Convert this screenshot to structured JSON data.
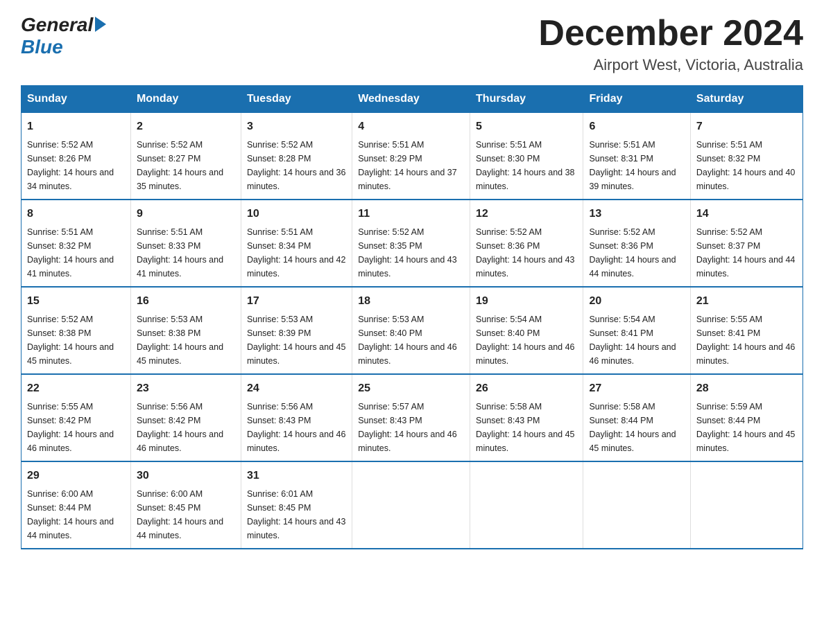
{
  "logo": {
    "text1": "General",
    "text2": "Blue"
  },
  "title": "December 2024",
  "location": "Airport West, Victoria, Australia",
  "days_of_week": [
    "Sunday",
    "Monday",
    "Tuesday",
    "Wednesday",
    "Thursday",
    "Friday",
    "Saturday"
  ],
  "weeks": [
    [
      {
        "day": "1",
        "sunrise": "5:52 AM",
        "sunset": "8:26 PM",
        "daylight": "14 hours and 34 minutes."
      },
      {
        "day": "2",
        "sunrise": "5:52 AM",
        "sunset": "8:27 PM",
        "daylight": "14 hours and 35 minutes."
      },
      {
        "day": "3",
        "sunrise": "5:52 AM",
        "sunset": "8:28 PM",
        "daylight": "14 hours and 36 minutes."
      },
      {
        "day": "4",
        "sunrise": "5:51 AM",
        "sunset": "8:29 PM",
        "daylight": "14 hours and 37 minutes."
      },
      {
        "day": "5",
        "sunrise": "5:51 AM",
        "sunset": "8:30 PM",
        "daylight": "14 hours and 38 minutes."
      },
      {
        "day": "6",
        "sunrise": "5:51 AM",
        "sunset": "8:31 PM",
        "daylight": "14 hours and 39 minutes."
      },
      {
        "day": "7",
        "sunrise": "5:51 AM",
        "sunset": "8:32 PM",
        "daylight": "14 hours and 40 minutes."
      }
    ],
    [
      {
        "day": "8",
        "sunrise": "5:51 AM",
        "sunset": "8:32 PM",
        "daylight": "14 hours and 41 minutes."
      },
      {
        "day": "9",
        "sunrise": "5:51 AM",
        "sunset": "8:33 PM",
        "daylight": "14 hours and 41 minutes."
      },
      {
        "day": "10",
        "sunrise": "5:51 AM",
        "sunset": "8:34 PM",
        "daylight": "14 hours and 42 minutes."
      },
      {
        "day": "11",
        "sunrise": "5:52 AM",
        "sunset": "8:35 PM",
        "daylight": "14 hours and 43 minutes."
      },
      {
        "day": "12",
        "sunrise": "5:52 AM",
        "sunset": "8:36 PM",
        "daylight": "14 hours and 43 minutes."
      },
      {
        "day": "13",
        "sunrise": "5:52 AM",
        "sunset": "8:36 PM",
        "daylight": "14 hours and 44 minutes."
      },
      {
        "day": "14",
        "sunrise": "5:52 AM",
        "sunset": "8:37 PM",
        "daylight": "14 hours and 44 minutes."
      }
    ],
    [
      {
        "day": "15",
        "sunrise": "5:52 AM",
        "sunset": "8:38 PM",
        "daylight": "14 hours and 45 minutes."
      },
      {
        "day": "16",
        "sunrise": "5:53 AM",
        "sunset": "8:38 PM",
        "daylight": "14 hours and 45 minutes."
      },
      {
        "day": "17",
        "sunrise": "5:53 AM",
        "sunset": "8:39 PM",
        "daylight": "14 hours and 45 minutes."
      },
      {
        "day": "18",
        "sunrise": "5:53 AM",
        "sunset": "8:40 PM",
        "daylight": "14 hours and 46 minutes."
      },
      {
        "day": "19",
        "sunrise": "5:54 AM",
        "sunset": "8:40 PM",
        "daylight": "14 hours and 46 minutes."
      },
      {
        "day": "20",
        "sunrise": "5:54 AM",
        "sunset": "8:41 PM",
        "daylight": "14 hours and 46 minutes."
      },
      {
        "day": "21",
        "sunrise": "5:55 AM",
        "sunset": "8:41 PM",
        "daylight": "14 hours and 46 minutes."
      }
    ],
    [
      {
        "day": "22",
        "sunrise": "5:55 AM",
        "sunset": "8:42 PM",
        "daylight": "14 hours and 46 minutes."
      },
      {
        "day": "23",
        "sunrise": "5:56 AM",
        "sunset": "8:42 PM",
        "daylight": "14 hours and 46 minutes."
      },
      {
        "day": "24",
        "sunrise": "5:56 AM",
        "sunset": "8:43 PM",
        "daylight": "14 hours and 46 minutes."
      },
      {
        "day": "25",
        "sunrise": "5:57 AM",
        "sunset": "8:43 PM",
        "daylight": "14 hours and 46 minutes."
      },
      {
        "day": "26",
        "sunrise": "5:58 AM",
        "sunset": "8:43 PM",
        "daylight": "14 hours and 45 minutes."
      },
      {
        "day": "27",
        "sunrise": "5:58 AM",
        "sunset": "8:44 PM",
        "daylight": "14 hours and 45 minutes."
      },
      {
        "day": "28",
        "sunrise": "5:59 AM",
        "sunset": "8:44 PM",
        "daylight": "14 hours and 45 minutes."
      }
    ],
    [
      {
        "day": "29",
        "sunrise": "6:00 AM",
        "sunset": "8:44 PM",
        "daylight": "14 hours and 44 minutes."
      },
      {
        "day": "30",
        "sunrise": "6:00 AM",
        "sunset": "8:45 PM",
        "daylight": "14 hours and 44 minutes."
      },
      {
        "day": "31",
        "sunrise": "6:01 AM",
        "sunset": "8:45 PM",
        "daylight": "14 hours and 43 minutes."
      },
      null,
      null,
      null,
      null
    ]
  ],
  "accent_color": "#1a6faf"
}
